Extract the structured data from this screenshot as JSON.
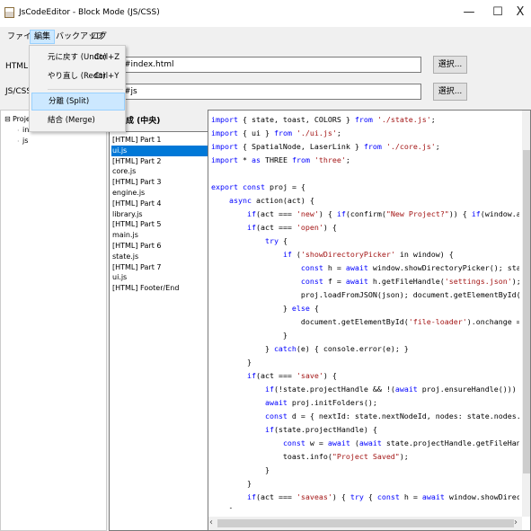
{
  "window": {
    "title": "JsCodeEditor - Block Mode (JS/CSS)",
    "minimize": "—",
    "maximize": "☐",
    "close": "X"
  },
  "menubar": [
    "ファイル",
    "編集",
    "バックアップ",
    "ログ"
  ],
  "edit_menu": [
    {
      "label": "元に戻す (Undo)",
      "shortcut": "Ctrl+Z"
    },
    {
      "label": "やり直し (Redo)",
      "shortcut": "Ctrl+Y"
    },
    {
      "label": "分離 (Split)",
      "shortcut": ""
    },
    {
      "label": "結合 (Merge)",
      "shortcut": ""
    }
  ],
  "html_row": {
    "label": "HTMLファ",
    "value": "#index.html",
    "button": "選択..."
  },
  "js_row": {
    "label": "JS/CSS",
    "value": "#js",
    "button": "選択..."
  },
  "tree": {
    "root": "Project",
    "items": [
      "index.html",
      "js"
    ]
  },
  "list": {
    "header": "ク構成 (中央)",
    "selected_index": 1,
    "items": [
      "[HTML] Part 1",
      "ui.js",
      "[HTML] Part 2",
      "core.js",
      "[HTML] Part 3",
      "engine.js",
      "[HTML] Part 4",
      "library.js",
      "[HTML] Part 5",
      "main.js",
      "[HTML] Part 6",
      "state.js",
      "[HTML] Part 7",
      "ui.js",
      "[HTML] Footer/End"
    ]
  },
  "editor": {
    "lines": [
      "import { state, toast, COLORS } from './state.js';",
      "import { ui } from './ui.js';",
      "import { SpatialNode, LaserLink } from './core.js';",
      "import * as THREE from 'three';",
      "",
      "export const proj = {",
      "    async action(act) {",
      "        if(act === 'new') { if(confirm(\"New Project?\")) { if(window.app) window.app.clearSc",
      "        if(act === 'open') {",
      "            try {",
      "                if ('showDirectoryPicker' in window) {",
      "                    const h = await window.showDirectoryPicker(); state.projectHandle = h;",
      "                    const f = await h.getFileHandle('settings.json'); const json = JSON.par",
      "                    proj.loadFromJSON(json); document.getElementById('status-text').innerTe",
      "                } else {",
      "                    document.getElementById('file-loader').onchange = async (e) => { if(e.t",
      "                }",
      "            } catch(e) { console.error(e); }",
      "        }",
      "        if(act === 'save') {",
      "            if(!state.projectHandle && !(await proj.ensureHandle())) return;",
      "            await proj.initFolders();",
      "            const d = { nextId: state.nextNodeId, nodes: state.nodes.map(n=>n.serialize()),",
      "            if(state.projectHandle) {",
      "                const w = await (await state.projectHandle.getFileHandle('settings.json',{c",
      "                toast.info(\"Project Saved\");",
      "            }",
      "        }",
      "        if(act === 'saveas') { try { const h = await window.showDirectoryPicker(); state.pr",
      "    }"
    ],
    "scroll_left": "‹",
    "scroll_right": "›"
  },
  "colors": {
    "keyword": "#0000ff",
    "string": "#a31515",
    "function": "#795e26",
    "selection": "#0078d7",
    "menu_highlight": "#cce8ff"
  }
}
